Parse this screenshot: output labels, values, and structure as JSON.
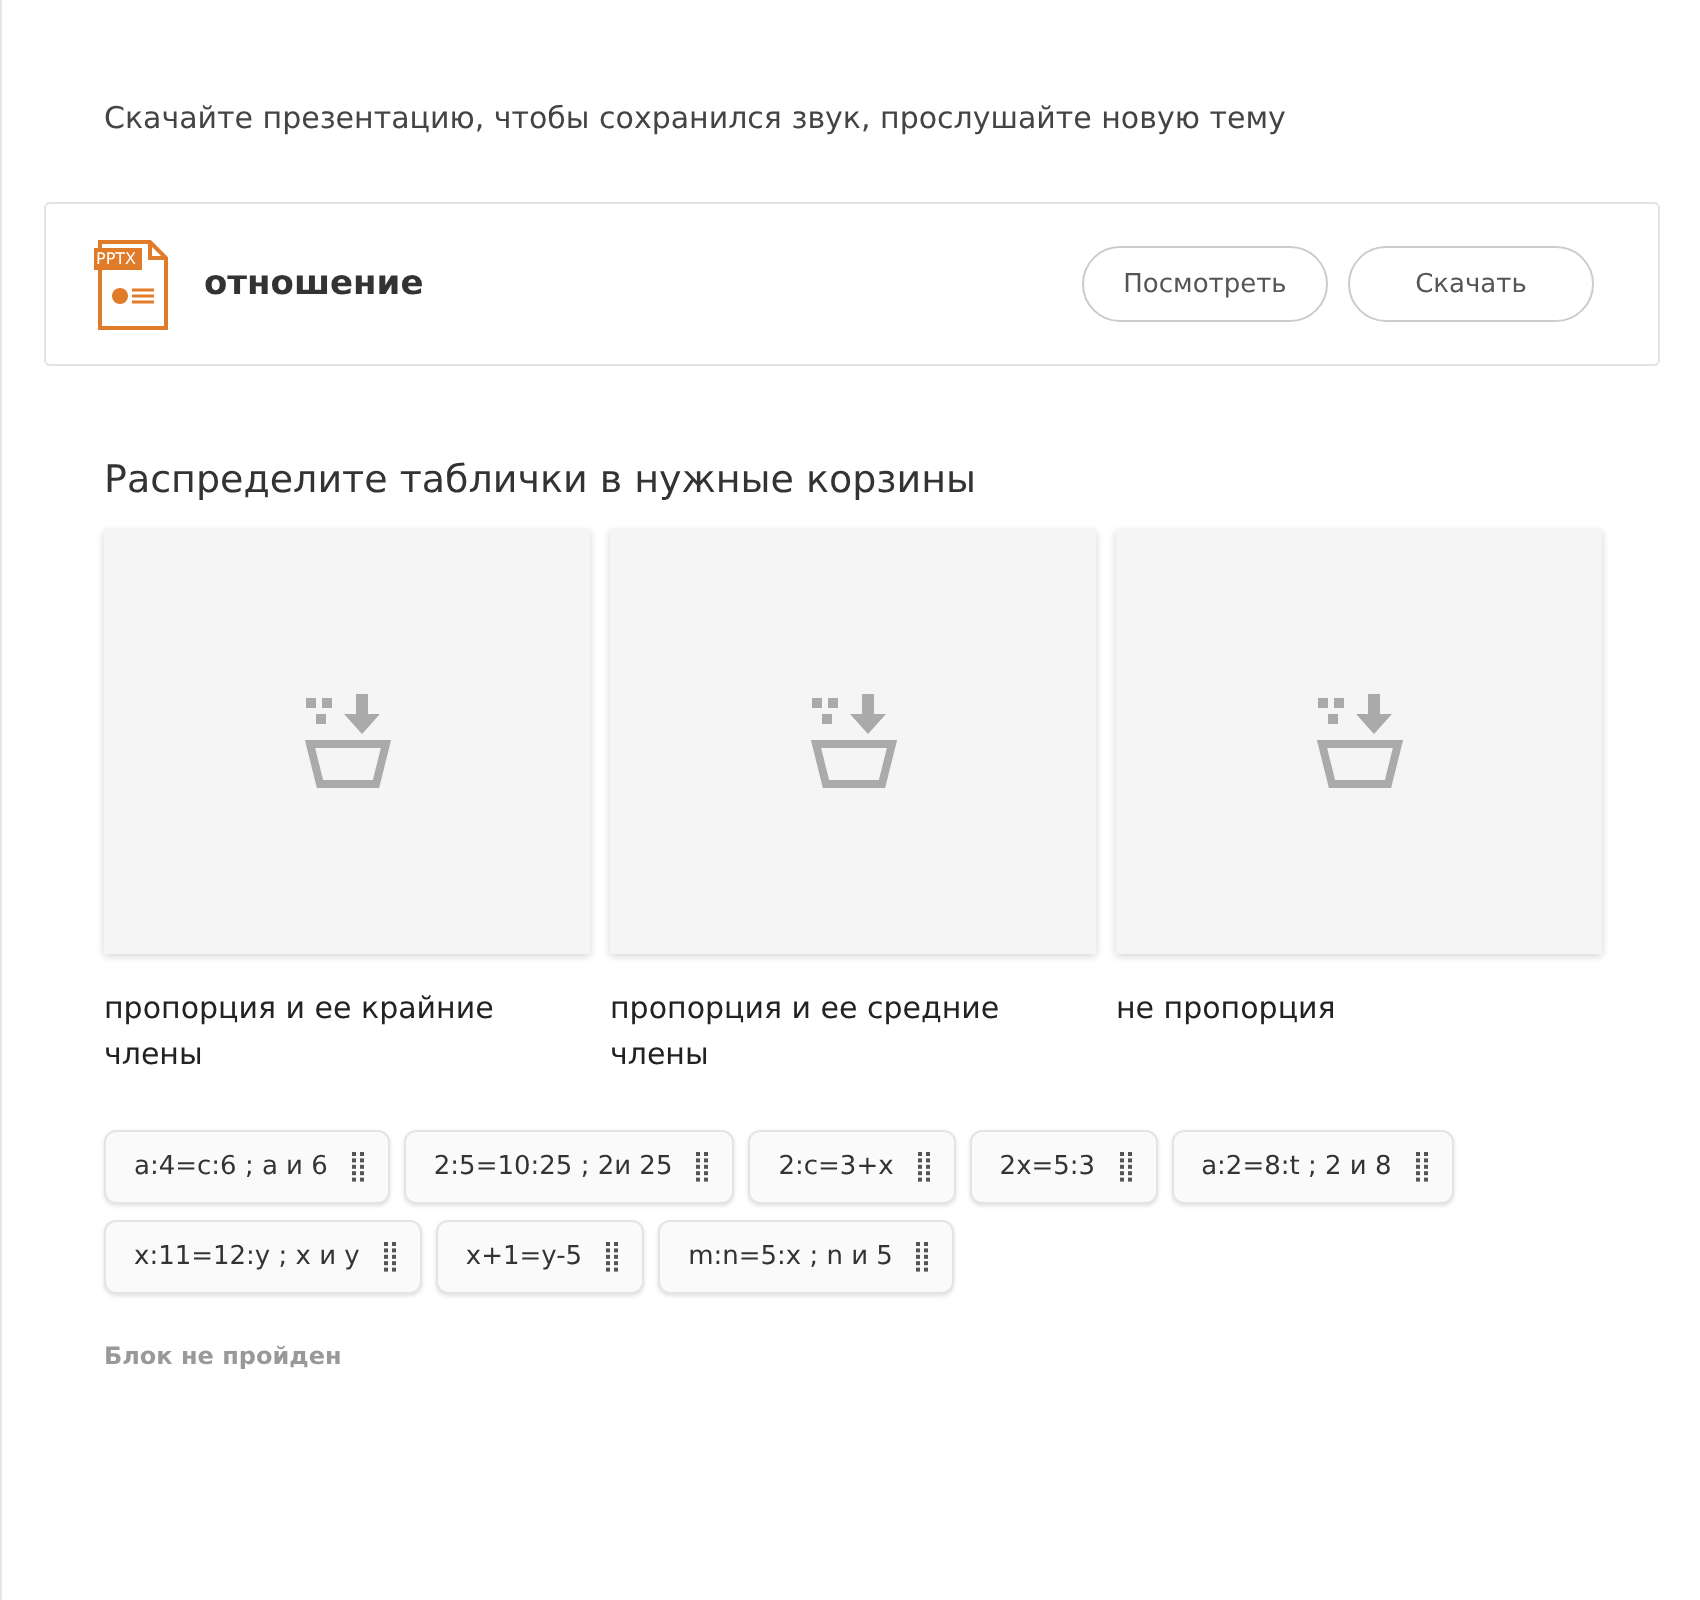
{
  "intro": "Скачайте презентацию, чтобы сохранился звук, прослушайте новую тему",
  "file": {
    "badge": "PPTX",
    "name": "отношение",
    "buttons": [
      "Посмотреть",
      "Скачать"
    ]
  },
  "task": {
    "title": "Распределите таблички в нужные корзины",
    "baskets": [
      {
        "label": "пропорция и ее крайние члены"
      },
      {
        "label": "пропорция и ее средние члены"
      },
      {
        "label": "не пропорция"
      }
    ],
    "cards": [
      {
        "text": "a:4=c:6 ; a и 6"
      },
      {
        "text": "2:5=10:25 ; 2и 25"
      },
      {
        "text": "2:c=3+x"
      },
      {
        "text": "2x=5:3"
      },
      {
        "text": "a:2=8:t ; 2 и 8"
      },
      {
        "text": "x:11=12:y ; x и y"
      },
      {
        "text": "x+1=y-5"
      },
      {
        "text": "m:n=5:x ; n и 5"
      }
    ],
    "status": "Блок не пройден"
  }
}
